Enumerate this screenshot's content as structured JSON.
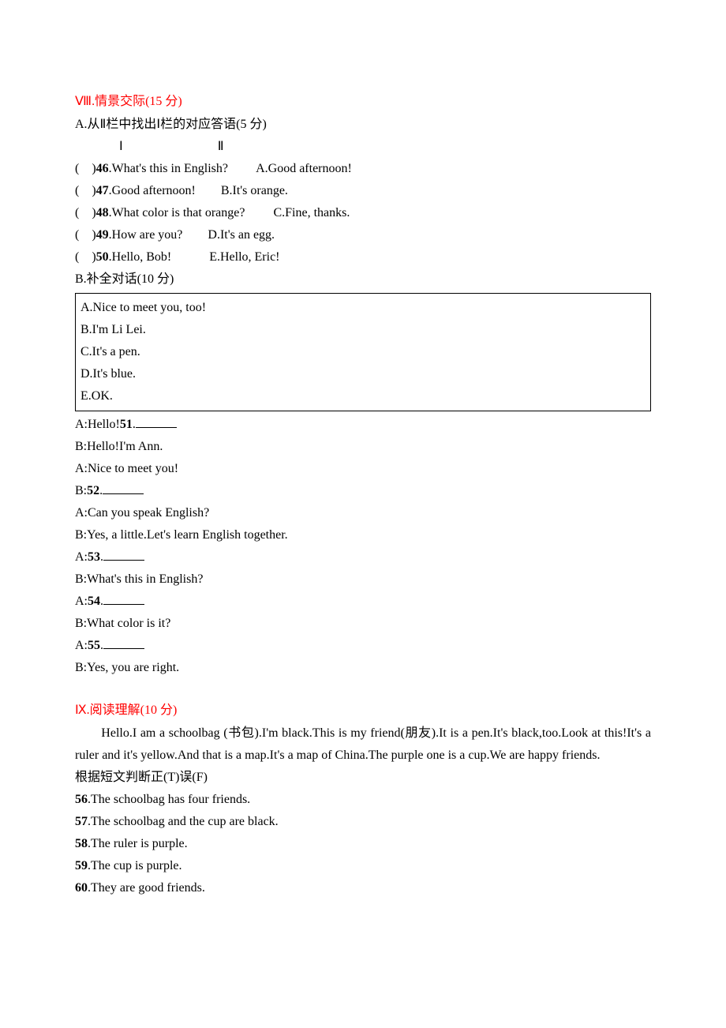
{
  "s8": {
    "title": "Ⅷ.情景交际(15 分)",
    "partA_instr": "A.从Ⅱ栏中找出Ⅰ栏的对应答语(5 分)",
    "colI": "Ⅰ",
    "colII": "Ⅱ",
    "q46": {
      "num": "46",
      "q": "What's this in English?",
      "a": "A.Good afternoon!"
    },
    "q47": {
      "num": "47",
      "q": "Good afternoon!",
      "a": "B.It's orange."
    },
    "q48": {
      "num": "48",
      "q": "What color is that orange?",
      "a": "C.Fine, thanks."
    },
    "q49": {
      "num": "49",
      "q": "How are you?",
      "a": "D.It's an egg."
    },
    "q50": {
      "num": "50",
      "q": "Hello, Bob!",
      "a": "E.Hello, Eric!"
    },
    "partB_instr": "B.补全对话(10 分)",
    "boxA": "A.Nice to meet you, too!",
    "boxB": "B.I'm Li Lei.",
    "boxC": "C.It's a pen.",
    "boxD": "D.It's blue.",
    "boxE": "E.OK.",
    "d1a": "A:Hello!",
    "d1num": "51",
    "d2": "B:Hello!I'm Ann.",
    "d3": "A:Nice to meet you!",
    "d4a": "B:",
    "d4num": "52",
    "d5": "A:Can you speak English?",
    "d6": "B:Yes, a little.Let's learn English together.",
    "d7a": "A:",
    "d7num": "53",
    "d8": "B:What's this in English?",
    "d9a": "A:",
    "d9num": "54",
    "d10": "B:What color is it?",
    "d11a": "A:",
    "d11num": "55",
    "d12": "B:Yes, you are right."
  },
  "s9": {
    "title": "Ⅸ.阅读理解(10 分)",
    "passage": "Hello.I am a schoolbag (书包).I'm black.This is my friend(朋友).It is a pen.It's black,too.Look at this!It's a ruler and it's yellow.And that is a map.It's a map of China.The purple one is a cup.We are happy friends.",
    "instr": "根据短文判断正(T)误(F)",
    "q56": {
      "num": "56",
      "t": "The schoolbag has four friends."
    },
    "q57": {
      "num": "57",
      "t": "The schoolbag and the cup are black."
    },
    "q58": {
      "num": "58",
      "t": "The ruler is purple."
    },
    "q59": {
      "num": "59",
      "t": "The cup is purple."
    },
    "q60": {
      "num": "60",
      "t": "They are good friends."
    }
  }
}
